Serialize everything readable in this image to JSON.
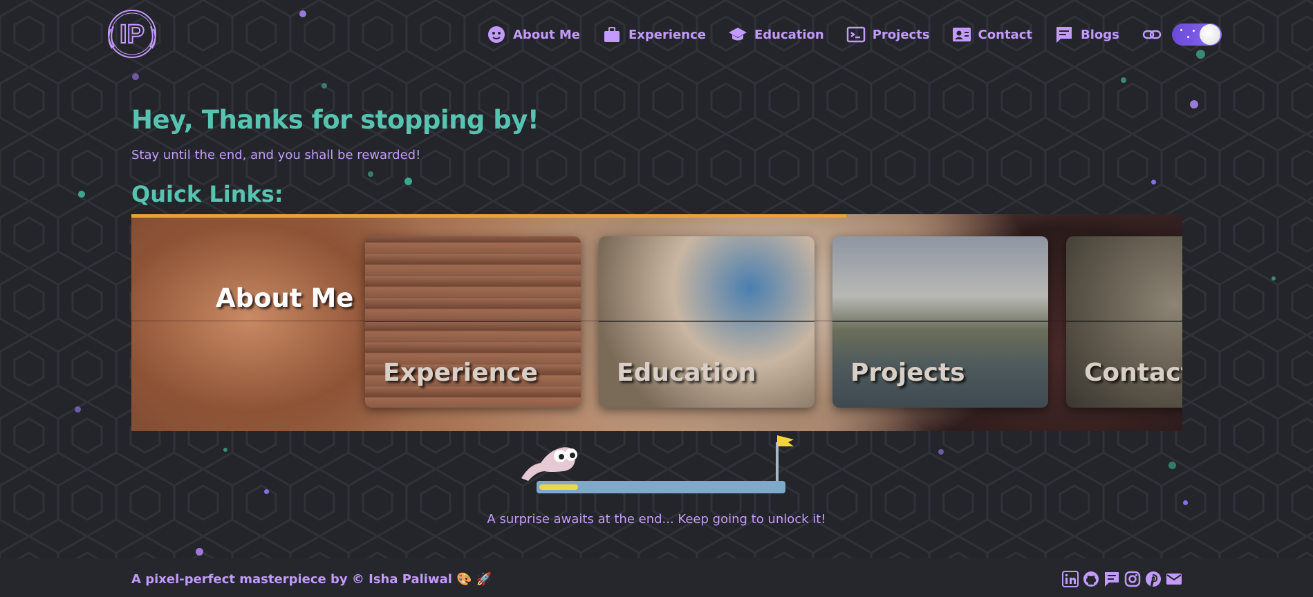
{
  "header": {
    "logo_text": "IP",
    "nav": [
      {
        "label": "About Me",
        "icon": "user-face-icon"
      },
      {
        "label": "Experience",
        "icon": "briefcase-icon"
      },
      {
        "label": "Education",
        "icon": "graduation-cap-icon"
      },
      {
        "label": "Projects",
        "icon": "terminal-icon"
      },
      {
        "label": "Contact",
        "icon": "contact-card-icon"
      },
      {
        "label": "Blogs",
        "icon": "message-icon"
      }
    ],
    "link_icon": "link-icon",
    "theme_toggle": {
      "state": "dark",
      "icon": "moon-icon"
    }
  },
  "main": {
    "greeting": "Hey, Thanks for stopping by!",
    "subtitle": "Stay until the end, and you shall be rewarded!",
    "quick_links_title": "Quick Links:",
    "carousel": {
      "active_title": "About Me",
      "progress": 0.68,
      "cards": [
        "Experience",
        "Education",
        "Projects",
        "Contact"
      ]
    },
    "game": {
      "progress": 0.16,
      "flag_icon": "flag-icon",
      "character_icon": "worm-character-icon"
    },
    "surprise_text": "A surprise awaits at the end... Keep going to unlock it!"
  },
  "footer": {
    "credit": "A pixel-perfect masterpiece by © Isha Paliwal 🎨 🚀",
    "socials": [
      "linkedin-icon",
      "github-icon",
      "blog-icon",
      "instagram-icon",
      "pinterest-icon",
      "mail-icon"
    ]
  },
  "colors": {
    "accent_purple": "#c39bff",
    "accent_teal": "#56c4b0",
    "background": "#23252b",
    "progress_orange": "#e5a43b"
  }
}
